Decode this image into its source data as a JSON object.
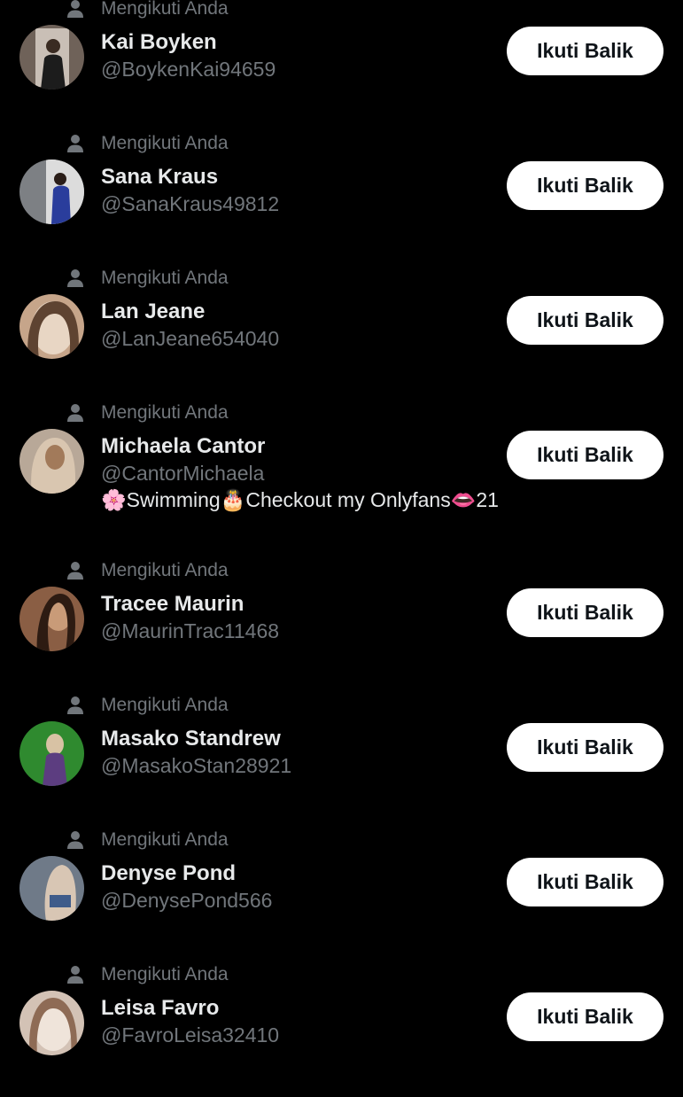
{
  "accounts": [
    {
      "status": "Mengikuti Anda",
      "name": "Kai Boyken",
      "handle": "@BoykenKai94659",
      "bio": "",
      "button": "Ikuti Balik",
      "avatar_colors": [
        "#6f6259",
        "#c9bfb6",
        "#1c1c1c"
      ]
    },
    {
      "status": "Mengikuti Anda",
      "name": "Sana Kraus",
      "handle": "@SanaKraus49812",
      "bio": "",
      "button": "Ikuti Balik",
      "avatar_colors": [
        "#7d8084",
        "#dcdcdc",
        "#2a3d9c"
      ]
    },
    {
      "status": "Mengikuti Anda",
      "name": "Lan Jeane",
      "handle": "@LanJeane654040",
      "bio": "",
      "button": "Ikuti Balik",
      "avatar_colors": [
        "#c6a58a",
        "#e8d6c4",
        "#5e4331"
      ]
    },
    {
      "status": "Mengikuti Anda",
      "name": "Michaela Cantor",
      "handle": "@CantorMichaela",
      "bio": "🌸Swimming🎂Checkout my Onlyfans👄21",
      "button": "Ikuti Balik",
      "avatar_colors": [
        "#b8a898",
        "#d9c6b0",
        "#a27a5a"
      ]
    },
    {
      "status": "Mengikuti Anda",
      "name": "Tracee Maurin",
      "handle": "@MaurinTrac11468",
      "bio": "",
      "button": "Ikuti Balik",
      "avatar_colors": [
        "#8a5e44",
        "#c99b78",
        "#2d1b12"
      ]
    },
    {
      "status": "Mengikuti Anda",
      "name": "Masako Standrew",
      "handle": "@MasakoStan28921",
      "bio": "",
      "button": "Ikuti Balik",
      "avatar_colors": [
        "#2f8a2f",
        "#d8c2a4",
        "#5c3d80"
      ]
    },
    {
      "status": "Mengikuti Anda",
      "name": "Denyse Pond",
      "handle": "@DenysePond566",
      "bio": "",
      "button": "Ikuti Balik",
      "avatar_colors": [
        "#6f7a88",
        "#d8c6b4",
        "#3f5c8a"
      ]
    },
    {
      "status": "Mengikuti Anda",
      "name": "Leisa Favro",
      "handle": "@FavroLeisa32410",
      "bio": "",
      "button": "Ikuti Balik",
      "avatar_colors": [
        "#d3c2b5",
        "#efe4da",
        "#8e6b55"
      ]
    }
  ],
  "icons": {
    "status_icon": "person-icon"
  },
  "colors": {
    "background": "#000000",
    "primary_text": "#e7e9ea",
    "secondary_text": "#71767b",
    "button_bg": "#ffffff",
    "button_text": "#0f1419"
  }
}
